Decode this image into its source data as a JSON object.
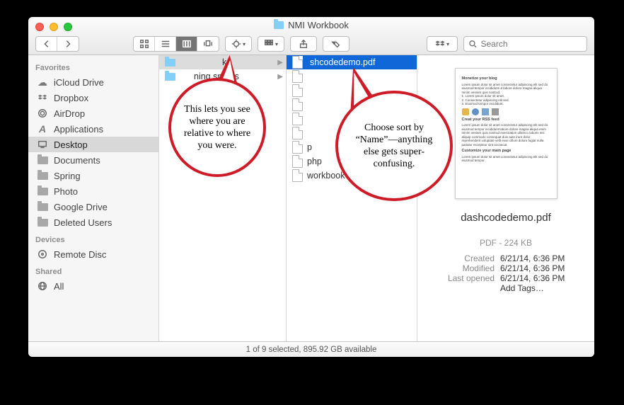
{
  "window_title": "NMI Workbook",
  "search_placeholder": "Search",
  "sidebar": {
    "sections": [
      {
        "label": "Favorites",
        "items": [
          {
            "label": "iCloud Drive",
            "icon": "cloud"
          },
          {
            "label": "Dropbox",
            "icon": "dropbox"
          },
          {
            "label": "AirDrop",
            "icon": "airdrop"
          },
          {
            "label": "Applications",
            "icon": "apps"
          },
          {
            "label": "Desktop",
            "icon": "desktop",
            "selected": true
          },
          {
            "label": "Documents",
            "icon": "folder"
          },
          {
            "label": "Spring",
            "icon": "folder"
          },
          {
            "label": "Photo",
            "icon": "folder"
          },
          {
            "label": "Google Drive",
            "icon": "folder"
          },
          {
            "label": "Deleted Users",
            "icon": "folder"
          }
        ]
      },
      {
        "label": "Devices",
        "items": [
          {
            "label": "Remote Disc",
            "icon": "disc"
          }
        ]
      },
      {
        "label": "Shared",
        "items": [
          {
            "label": "All",
            "icon": "globe"
          }
        ]
      }
    ]
  },
  "column1": [
    {
      "label": "k",
      "icon": "folder",
      "expandable": true,
      "pointed": true
    },
    {
      "label": "ning sprints",
      "icon": "folder",
      "expandable": true
    }
  ],
  "column2_selected_label": "shcodedemo.pdf",
  "column2_rest": [
    {
      "label": ""
    },
    {
      "label": ""
    },
    {
      "label": ""
    },
    {
      "label": ""
    },
    {
      "label": ""
    },
    {
      "label": "p"
    },
    {
      "label": "php"
    },
    {
      "label": "workbook"
    }
  ],
  "preview": {
    "filename": "dashcodedemo.pdf",
    "kind": "PDF - 224 KB",
    "created_label": "Created",
    "created_value": "6/21/14, 6:36 PM",
    "modified_label": "Modified",
    "modified_value": "6/21/14, 6:36 PM",
    "opened_label": "Last opened",
    "opened_value": "6/21/14, 6:36 PM",
    "tags_label": "Add Tags…"
  },
  "statusbar": "1 of 9 selected, 895.92 GB available",
  "annotations": {
    "bubble1": "This lets you see where you are relative to where you were.",
    "bubble2": "Choose sort by “Name”—anything else gets super-confusing."
  }
}
